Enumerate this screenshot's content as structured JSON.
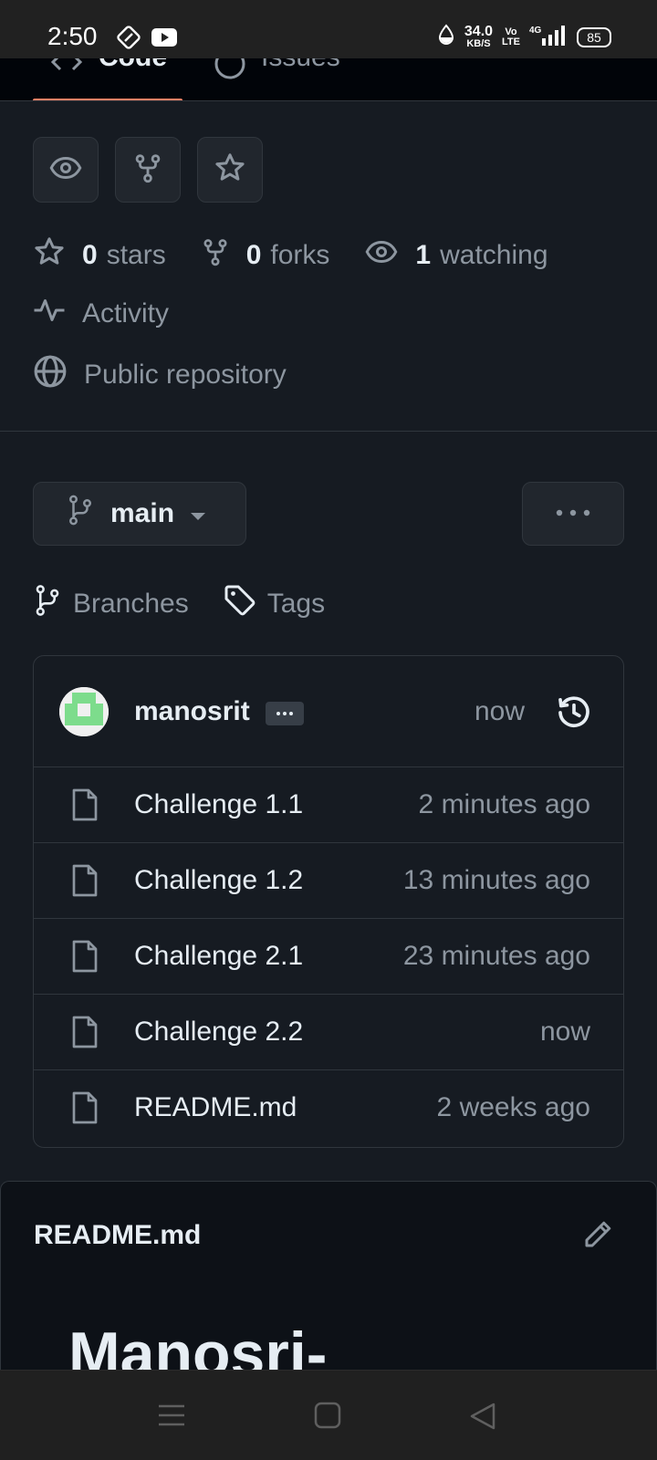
{
  "status_bar": {
    "time": "2:50",
    "net_speed_value": "34.0",
    "net_speed_unit": "KB/S",
    "volte_top": "Vo",
    "volte_bottom": "LTE",
    "network": "4G",
    "battery": "85"
  },
  "repo_tabs": {
    "code": "Code",
    "issues": "Issues"
  },
  "stats": {
    "stars_count": "0",
    "stars_label": "stars",
    "forks_count": "0",
    "forks_label": "forks",
    "watching_count": "1",
    "watching_label": "watching"
  },
  "meta": {
    "activity": "Activity",
    "visibility": "Public repository"
  },
  "branch": {
    "name": "main"
  },
  "links": {
    "branches": "Branches",
    "tags": "Tags"
  },
  "latest_commit": {
    "author": "manosrit",
    "time": "now"
  },
  "files": [
    {
      "name": "Challenge 1.1",
      "time": "2 minutes ago"
    },
    {
      "name": "Challenge 1.2",
      "time": "13 minutes ago"
    },
    {
      "name": "Challenge 2.1",
      "time": "23 minutes ago"
    },
    {
      "name": "Challenge 2.2",
      "time": "now"
    },
    {
      "name": "README.md",
      "time": "2 weeks ago"
    }
  ],
  "readme": {
    "title": "README.md",
    "heading": "Manosri-"
  },
  "colors": {
    "accent_underline": "#f78166",
    "background": "#161b22",
    "border": "#30363d"
  }
}
